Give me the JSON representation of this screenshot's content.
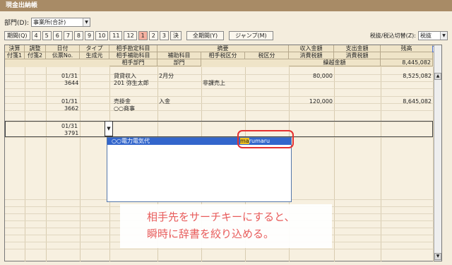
{
  "window": {
    "title": "現金出納帳"
  },
  "dept": {
    "label": "部門(D):",
    "value": "事業所(合計)"
  },
  "periods": {
    "label": "期間(Q)",
    "items": [
      "4",
      "5",
      "6",
      "7",
      "8",
      "9",
      "10",
      "11",
      "12",
      "1",
      "2",
      "3",
      "決"
    ],
    "active": "1",
    "all_label": "全期間(Y)",
    "jump_label": "ジャンプ(M)"
  },
  "tax": {
    "label": "税抜/税込切替(Z):",
    "value": "税抜"
  },
  "headers": {
    "r1": [
      "決算",
      "調整",
      "日付",
      "タイプ",
      "相手勘定科目",
      "摘要",
      "収入金額",
      "支出金額",
      "残高"
    ],
    "r2": [
      "付箋1",
      "付箋2",
      "伝票No.",
      "生成元",
      "相手補助科目",
      "補助科目",
      "相手税区分",
      "税区分",
      "消費税額",
      "消費税額"
    ],
    "r3": [
      "相手部門",
      "部門",
      "繰越金額"
    ],
    "carry_balance": "8,445,082"
  },
  "rows": [
    {
      "date": "01/31",
      "slip": "3644",
      "account": "貸貸収入",
      "sub": "201 弥生太郎",
      "memo": "2月分",
      "tax": "非課売上",
      "income": "80,000",
      "balance": "8,525,082"
    },
    {
      "date": "01/31",
      "slip": "3662",
      "account": "売掛金",
      "sub": "○○商事",
      "memo": "入金",
      "tax": "",
      "income": "120,000",
      "balance": "8,645,082"
    },
    {
      "date": "01/31",
      "slip": "3791",
      "account": "",
      "sub": "",
      "memo": "",
      "tax": "",
      "income": "",
      "balance": ""
    }
  ],
  "dropdown": {
    "selected_name": "○○電力電気代",
    "code_prefix": "ma",
    "code_rest": "rumaru"
  },
  "callout": {
    "line1": "相手先をサーチキーにすると、",
    "line2": "瞬時に辞書を絞り込める。"
  }
}
